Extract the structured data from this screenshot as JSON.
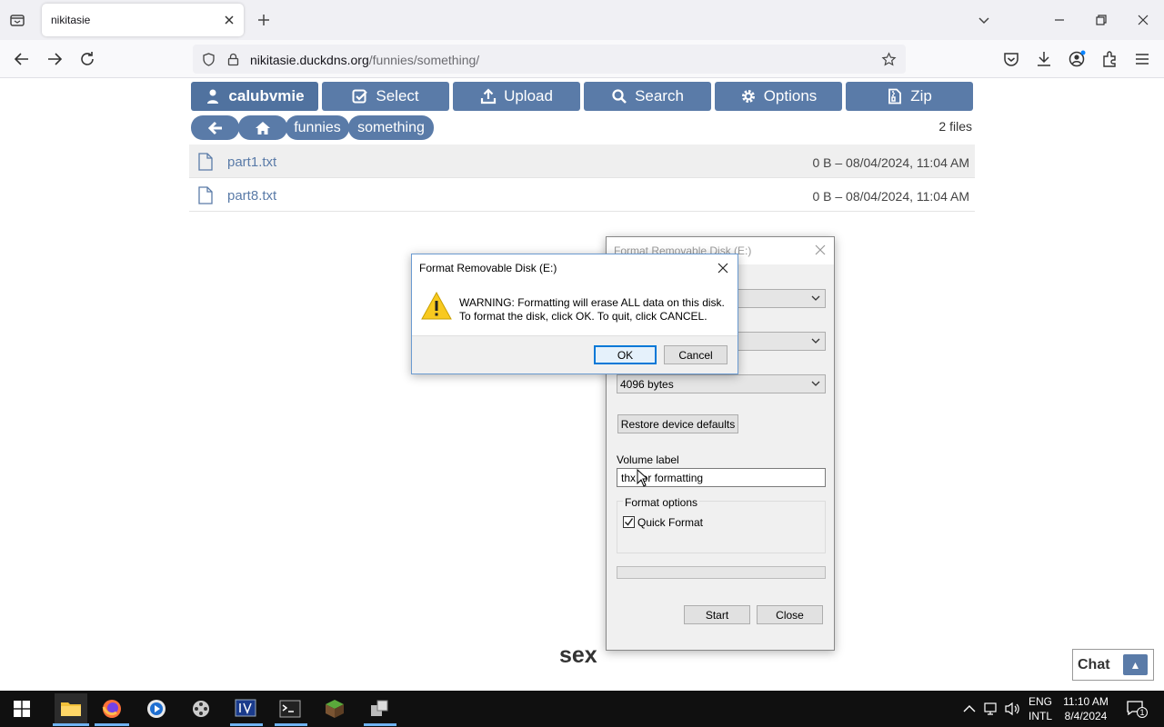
{
  "browser": {
    "tab_title": "nikitasie",
    "url_domain": "nikitasie.duckdns.org",
    "url_path": "/funnies/something/"
  },
  "ops": {
    "user": "calubvmie",
    "select": "Select",
    "upload": "Upload",
    "search": "Search",
    "options": "Options",
    "zip": "Zip"
  },
  "breadcrumbs": [
    "funnies",
    "something"
  ],
  "file_count": "2 files",
  "files": [
    {
      "name": "part1.txt",
      "meta": "0 B – 08/04/2024, 11:04 AM"
    },
    {
      "name": "part8.txt",
      "meta": "0 B – 08/04/2024, 11:04 AM"
    }
  ],
  "bottom_word": "sex",
  "chat": {
    "label": "Chat"
  },
  "format_dialog": {
    "title": "Format Removable Disk (E:)",
    "allocation_size": "4096 bytes",
    "restore_defaults": "Restore device defaults",
    "volume_label_caption": "Volume label",
    "volume_label_value": "thx for formatting",
    "format_options_caption": "Format options",
    "quick_format_label": "Quick Format",
    "quick_format_checked": true,
    "start": "Start",
    "close": "Close"
  },
  "warning_dialog": {
    "title": "Format Removable Disk (E:)",
    "line1": "WARNING: Formatting will erase ALL data on this disk.",
    "line2": "To format the disk, click OK. To quit, click CANCEL.",
    "ok": "OK",
    "cancel": "Cancel"
  },
  "taskbar": {
    "lang1": "ENG",
    "lang2": "INTL",
    "time": "11:10 AM",
    "date": "8/4/2024",
    "notification_count": "1"
  }
}
